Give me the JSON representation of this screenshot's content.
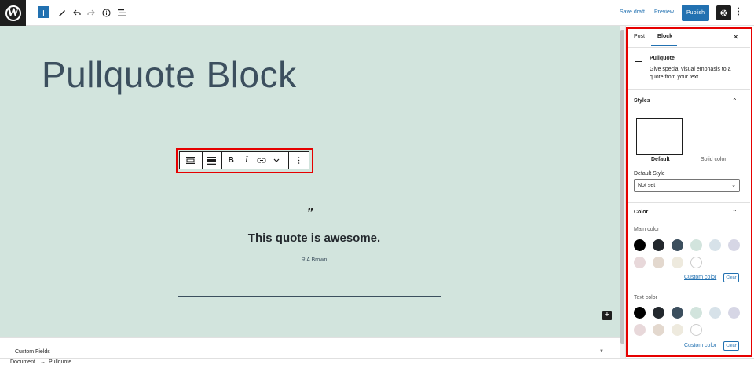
{
  "topbar": {
    "add_icon": "plus-icon",
    "tools_icon": "pencil-icon",
    "undo_icon": "undo-icon",
    "redo_icon": "redo-icon",
    "info_icon": "info-icon",
    "outline_icon": "list-view-icon",
    "save_draft": "Save draft",
    "preview": "Preview",
    "publish": "Publish",
    "settings_icon": "gear-icon",
    "more_icon": "kebab-icon",
    "accent": "#2271b1"
  },
  "editor": {
    "title": "Pullquote Block",
    "canvas_bg": "#d2e4dd",
    "pullquote": {
      "mark": "”",
      "text": "This quote is awesome.",
      "citation": "R A Brown"
    },
    "toolbar": [
      "block-type-icon",
      "align-icon",
      "bold-icon",
      "italic-icon",
      "link-icon",
      "chevron-down-icon",
      "more-options-icon"
    ]
  },
  "sidebar": {
    "tabs": [
      "Post",
      "Block"
    ],
    "active_tab": "Block",
    "close_icon": "close-icon",
    "block": {
      "name": "Pullquote",
      "description": "Give special visual emphasis to a quote from your text."
    },
    "styles": {
      "heading": "Styles",
      "options": [
        "Default",
        "Solid color"
      ],
      "default_style_label": "Default Style",
      "default_style_value": "Not set"
    },
    "color": {
      "heading": "Color",
      "main_color_label": "Main color",
      "text_color_label": "Text color",
      "palette": [
        "#000000",
        "#23282d",
        "#3c4f5e",
        "#d2e4dd",
        "#d7e2e9",
        "#d6d6e5",
        "#e8d8da",
        "#e3d8ce",
        "#eeeade",
        "#ffffff"
      ],
      "custom_color": "Custom color",
      "clear": "Clear"
    }
  },
  "bottom": {
    "custom_fields": "Custom Fields",
    "breadcrumb_document": "Document",
    "breadcrumb_arrow": "→",
    "breadcrumb_block": "Pullquote"
  },
  "highlight_color": "#e60000"
}
